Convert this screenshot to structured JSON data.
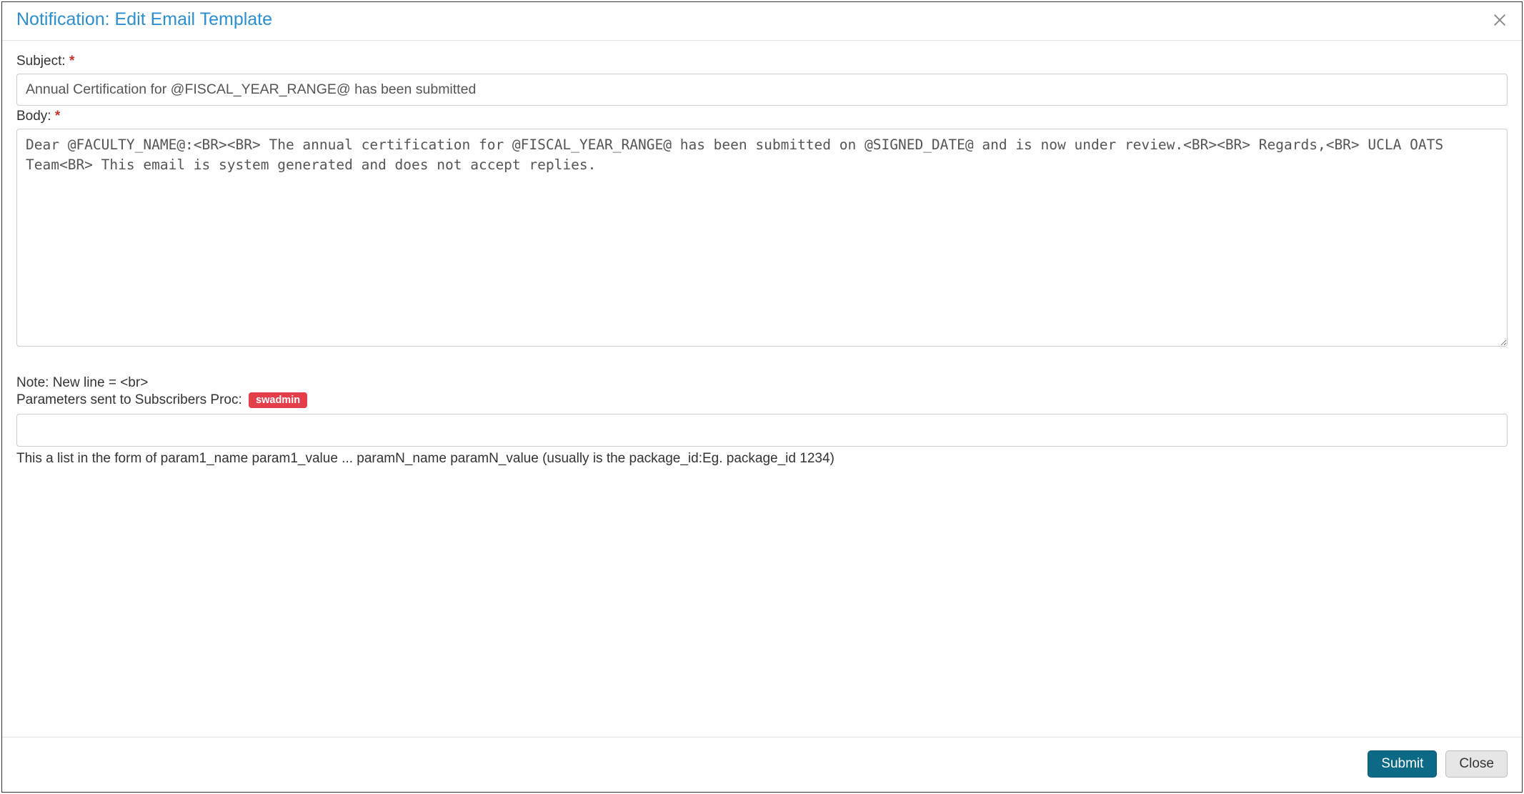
{
  "modal": {
    "title": "Notification: Edit Email Template"
  },
  "form": {
    "subject_label": "Subject:",
    "subject_value": "Annual Certification for @FISCAL_YEAR_RANGE@ has been submitted",
    "body_label": "Body:",
    "body_value": "Dear @FACULTY_NAME@:<BR><BR> The annual certification for @FISCAL_YEAR_RANGE@ has been submitted on @SIGNED_DATE@ and is now under review.<BR><BR> Regards,<BR> UCLA OATS Team<BR> This email is system generated and does not accept replies.",
    "note_text": "Note: New line = <br>",
    "params_label": "Parameters sent to Subscribers Proc:",
    "params_badge": "swadmin",
    "params_value": "",
    "params_help": "This a list in the form of param1_name param1_value ... paramN_name paramN_value (usually is the package_id:Eg. package_id 1234)",
    "required_marker": "*"
  },
  "footer": {
    "submit_label": "Submit",
    "close_label": "Close"
  }
}
